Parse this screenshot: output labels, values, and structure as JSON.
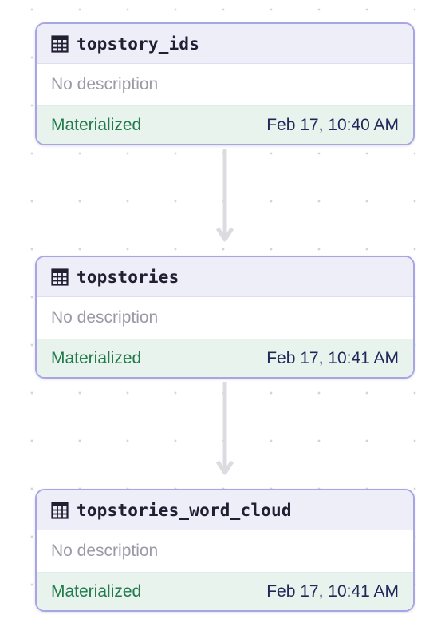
{
  "icons": {
    "table": "table-icon"
  },
  "colors": {
    "border": "#a7a6e3",
    "header_bg": "#eeeef9",
    "footer_bg": "#e9f3ee",
    "status_text": "#217a4a",
    "timestamp_text": "#1e2758",
    "edge": "#dcdce0"
  },
  "graph": {
    "nodes": [
      {
        "title": "topstory_ids",
        "description": "No description",
        "status": "Materialized",
        "timestamp": "Feb 17, 10:40 AM"
      },
      {
        "title": "topstories",
        "description": "No description",
        "status": "Materialized",
        "timestamp": "Feb 17, 10:41 AM"
      },
      {
        "title": "topstories_word_cloud",
        "description": "No description",
        "status": "Materialized",
        "timestamp": "Feb 17, 10:41 AM"
      }
    ]
  }
}
